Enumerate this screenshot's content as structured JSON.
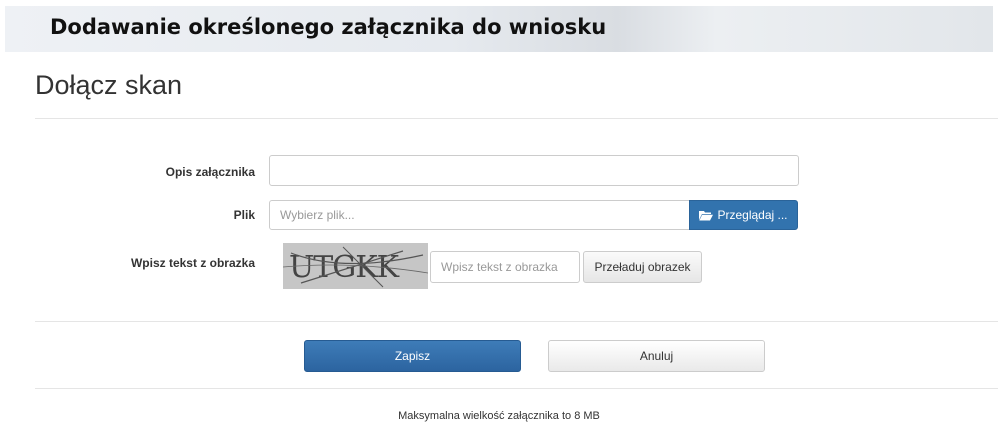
{
  "header": {
    "title": "Dodawanie określonego załącznika do wniosku"
  },
  "page": {
    "title": "Dołącz skan"
  },
  "form": {
    "description": {
      "label": "Opis załącznika",
      "value": "",
      "placeholder": ""
    },
    "file": {
      "label": "Plik",
      "placeholder": "Wybierz plik...",
      "browse_label": "Przeglądaj ...",
      "browse_icon": "folder-open-icon"
    },
    "captcha": {
      "label": "Wpisz tekst z obrazka",
      "image_text": "UTGKK",
      "placeholder": "Wpisz tekst z obrazka",
      "value": "",
      "reload_label": "Przeładuj obrazek"
    }
  },
  "actions": {
    "save_label": "Zapisz",
    "cancel_label": "Anuluj"
  },
  "footer": {
    "note": "Maksymalna wielkość załącznika to 8 MB"
  },
  "colors": {
    "primary": "#3273ae",
    "border": "#cccccc",
    "divider": "#e5e5e5"
  }
}
